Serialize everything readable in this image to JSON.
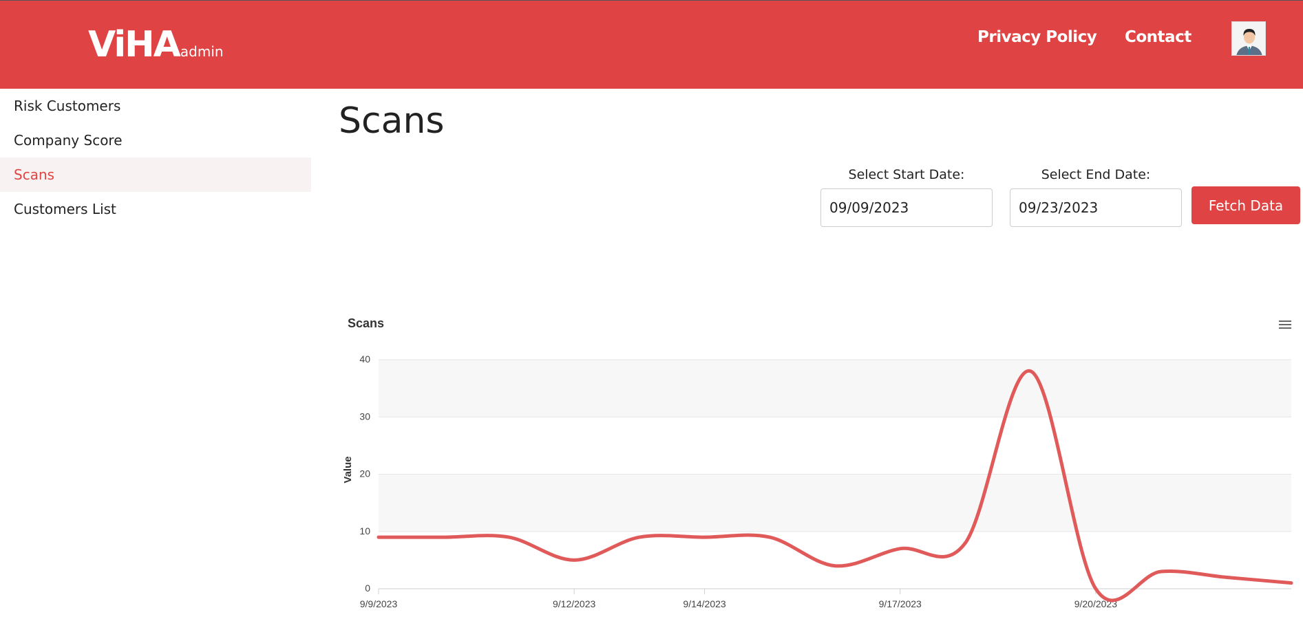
{
  "header": {
    "logo_main": "ViHA",
    "logo_sub": "admin",
    "nav": [
      {
        "label": "Privacy Policy"
      },
      {
        "label": "Contact"
      }
    ]
  },
  "sidebar": {
    "items": [
      {
        "label": "Risk Customers",
        "active": false
      },
      {
        "label": "Company Score",
        "active": false
      },
      {
        "label": "Scans",
        "active": true
      },
      {
        "label": "Customers List",
        "active": false
      }
    ]
  },
  "main": {
    "title": "Scans",
    "start_date_label": "Select Start Date:",
    "start_date_value": "09/09/2023",
    "end_date_label": "Select End Date:",
    "end_date_value": "09/23/2023",
    "fetch_button": "Fetch Data"
  },
  "colors": {
    "brand": "#e04343",
    "line": "#e05a5a"
  },
  "chart_data": {
    "type": "line",
    "title": "Scans",
    "ylabel": "Value",
    "xlabel": "",
    "ylim": [
      0,
      40
    ],
    "yticks": [
      0,
      10,
      20,
      30,
      40
    ],
    "xticks": [
      "9/9/2023",
      "9/12/2023",
      "9/14/2023",
      "9/17/2023",
      "9/20/2023"
    ],
    "x": [
      "2023-09-09",
      "2023-09-10",
      "2023-09-11",
      "2023-09-12",
      "2023-09-13",
      "2023-09-14",
      "2023-09-15",
      "2023-09-16",
      "2023-09-17",
      "2023-09-18",
      "2023-09-19",
      "2023-09-20",
      "2023-09-21",
      "2023-09-22",
      "2023-09-23"
    ],
    "series": [
      {
        "values": [
          9,
          9,
          9,
          5,
          9,
          9,
          9,
          4,
          7,
          8,
          38,
          0,
          3,
          2,
          1
        ]
      }
    ],
    "grid": true,
    "menu_icon": "hamburger-menu-icon"
  }
}
